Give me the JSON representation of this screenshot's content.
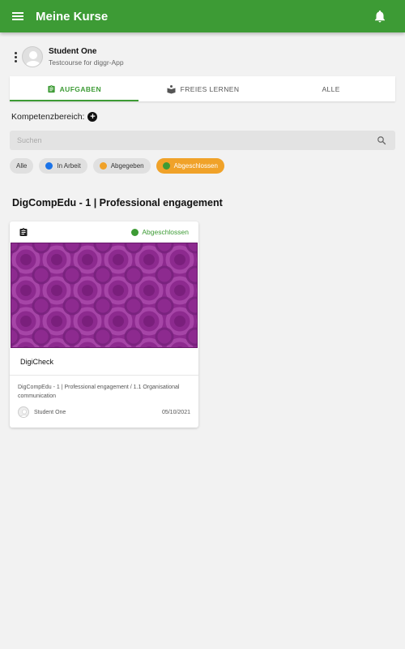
{
  "appbar": {
    "title": "Meine Kurse",
    "menu_icon": "menu-icon",
    "bell_icon": "bell-icon"
  },
  "user": {
    "name": "Student One",
    "course": "Testcourse for diggr-App"
  },
  "tabs": [
    {
      "label": "AUFGABEN",
      "icon": "clipboard-icon",
      "active": true
    },
    {
      "label": "FREIES LERNEN",
      "icon": "reader-icon",
      "active": false
    },
    {
      "label": "ALLE",
      "active": false
    }
  ],
  "kompetenz": {
    "label": "Kompetenzbereich:"
  },
  "search": {
    "placeholder": "Suchen",
    "value": ""
  },
  "filters": [
    {
      "label": "Alle",
      "color": null,
      "selected": false
    },
    {
      "label": "In Arbeit",
      "color": "#1a73e8",
      "selected": false
    },
    {
      "label": "Abgegeben",
      "color": "#f0a229",
      "selected": false
    },
    {
      "label": "Abgeschlossen",
      "color": "#3d9b35",
      "selected": true
    }
  ],
  "section": {
    "title": "DigCompEdu - 1 | Professional engagement"
  },
  "card": {
    "status": "Abgeschlossen",
    "title": "DigiCheck",
    "breadcrumb": "DigCompEdu - 1 | Professional engagement / 1.1 Organisational communication",
    "author": "Student One",
    "date": "05/10/2021"
  },
  "colors": {
    "primary": "#3d9b35",
    "accent_orange": "#f0a229",
    "in_progress_blue": "#1a73e8",
    "banner_purple": "#8d2a8f"
  }
}
